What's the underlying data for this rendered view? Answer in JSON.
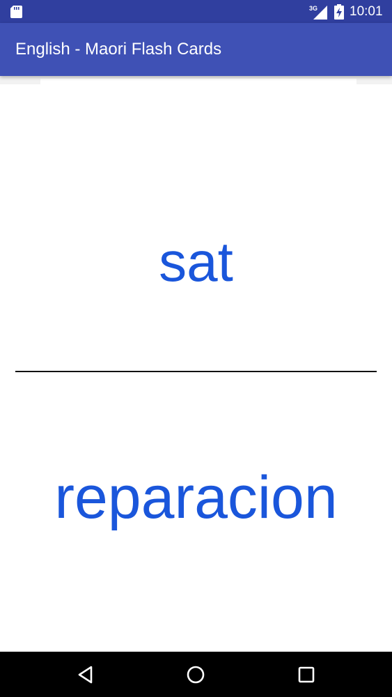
{
  "status_bar": {
    "network_type": "3G",
    "time": "10:01",
    "background_color": "#303f9f"
  },
  "app_bar": {
    "title": "English - Maori Flash Cards",
    "background_color": "#3f51b5"
  },
  "flash_card": {
    "english_word": "sat",
    "maori_word": "reparacion",
    "word_color": "#1a56db"
  },
  "nav_bar": {
    "back_icon": "triangle-back-icon",
    "home_icon": "circle-home-icon",
    "recents_icon": "square-recents-icon"
  }
}
